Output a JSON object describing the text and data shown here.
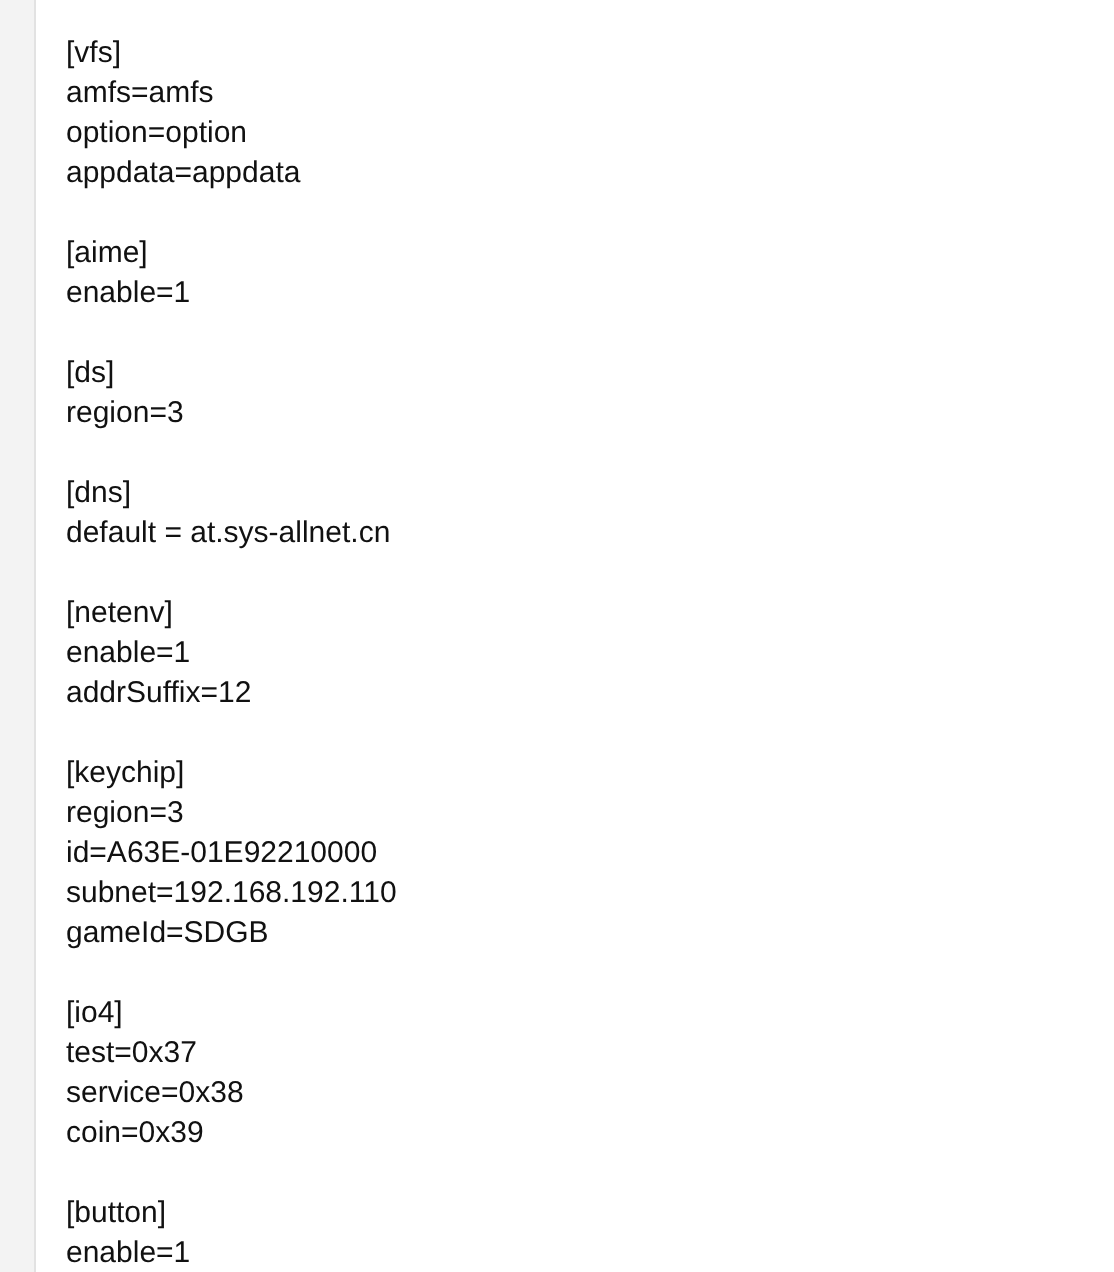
{
  "document": {
    "sections": [
      {
        "header": "[vfs]",
        "entries": [
          "amfs=amfs",
          "option=option",
          "appdata=appdata"
        ]
      },
      {
        "header": "[aime]",
        "entries": [
          "enable=1"
        ]
      },
      {
        "header": "[ds]",
        "entries": [
          "region=3"
        ]
      },
      {
        "header": "[dns]",
        "entries": [
          "default = at.sys-allnet.cn"
        ]
      },
      {
        "header": "[netenv]",
        "entries": [
          "enable=1",
          "addrSuffix=12"
        ]
      },
      {
        "header": "[keychip]",
        "entries": [
          "region=3",
          "id=A63E-01E92210000",
          "subnet=192.168.192.110",
          "gameId=SDGB"
        ]
      },
      {
        "header": "[io4]",
        "entries": [
          "test=0x37",
          "service=0x38",
          "coin=0x39"
        ]
      },
      {
        "header": "[button]",
        "entries": [
          "enable=1"
        ]
      }
    ]
  }
}
